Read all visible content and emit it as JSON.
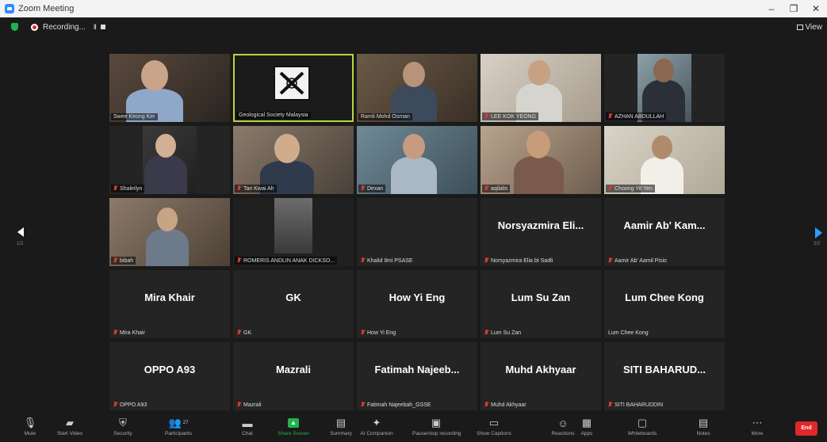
{
  "window": {
    "title": "Zoom Meeting",
    "controls": [
      "–",
      "❐",
      "✕"
    ]
  },
  "topbar": {
    "recording_label": "Recording...",
    "pause_label": "II",
    "view_label": "View"
  },
  "pagination": {
    "left_page": "1/2",
    "right_page": "2/2"
  },
  "tiles": [
    {
      "name": "Swee Keong Ker",
      "video": true,
      "muted": false
    },
    {
      "name": "Geological Society Malaysia",
      "video": true,
      "muted": false,
      "active": true
    },
    {
      "name": "Ramli Mohd Osman",
      "video": true,
      "muted": false
    },
    {
      "name": "LEE KOK YEONG",
      "video": true,
      "muted": true
    },
    {
      "name": "AZHAN ABDULLAH",
      "video": true,
      "muted": true
    },
    {
      "name": "Shaleilyn",
      "video": true,
      "muted": true
    },
    {
      "name": "Tan Kwai Ah",
      "video": true,
      "muted": true
    },
    {
      "name": "Dexan",
      "video": true,
      "muted": true
    },
    {
      "name": "aqilalis",
      "video": true,
      "muted": true
    },
    {
      "name": "Choong Yit Yen",
      "video": true,
      "muted": true
    },
    {
      "name": "bibah",
      "video": true,
      "muted": true
    },
    {
      "name": "ROMERIS ANDLIN ANAK DICKSO...",
      "video": true,
      "muted": true
    },
    {
      "name": "Khalid Ilmi PSASE",
      "display": "",
      "video": false,
      "muted": true
    },
    {
      "name": "Norsyazmira Elia bt Sadli",
      "display": "Norsyazmira  Eli...",
      "video": false,
      "muted": true
    },
    {
      "name": "Aamir Ab' Aamil Pisio",
      "display": "Aamir  Ab'  Kam...",
      "video": false,
      "muted": true
    },
    {
      "name": "Mira Khair",
      "display": "Mira Khair",
      "video": false,
      "muted": true
    },
    {
      "name": "GK",
      "display": "GK",
      "video": false,
      "muted": true
    },
    {
      "name": "How Yi Eng",
      "display": "How Yi Eng",
      "video": false,
      "muted": true
    },
    {
      "name": "Lum Su Zan",
      "display": "Lum Su Zan",
      "video": false,
      "muted": true
    },
    {
      "name": "Lum Chee Kong",
      "display": "Lum Chee Kong",
      "video": false,
      "muted": false
    },
    {
      "name": "OPPO A93",
      "display": "OPPO A93",
      "video": false,
      "muted": true
    },
    {
      "name": "Mazrali",
      "display": "Mazrali",
      "video": false,
      "muted": true
    },
    {
      "name": "Fatimah Najeebah_GSSE",
      "display": "Fatimah  Najeeb...",
      "video": false,
      "muted": true
    },
    {
      "name": "Muhd Akhyaar",
      "display": "Muhd Akhyaar",
      "video": false,
      "muted": true
    },
    {
      "name": "SITI BAHARUDDIN",
      "display": "SITI  BAHARUD...",
      "video": false,
      "muted": true
    }
  ],
  "toolbar": {
    "items": [
      {
        "key": "mute",
        "label": "Mute",
        "icon": "microphone-icon"
      },
      {
        "key": "video",
        "label": "Start Video",
        "icon": "video-off-icon"
      },
      {
        "key": "security",
        "label": "Security",
        "icon": "shield-icon"
      },
      {
        "key": "participants",
        "label": "Participants",
        "icon": "participants-icon",
        "count": "27"
      },
      {
        "key": "chat",
        "label": "Chat",
        "icon": "chat-icon"
      },
      {
        "key": "share",
        "label": "Share Screen",
        "icon": "share-screen-icon"
      },
      {
        "key": "summary",
        "label": "Summary",
        "icon": "summary-icon"
      },
      {
        "key": "ai",
        "label": "AI Companion",
        "icon": "sparkle-icon"
      },
      {
        "key": "record",
        "label": "Pause/stop recording",
        "icon": "record-icon"
      },
      {
        "key": "captions",
        "label": "Show Captions",
        "icon": "captions-icon"
      },
      {
        "key": "reactions",
        "label": "Reactions",
        "icon": "reactions-icon"
      },
      {
        "key": "apps",
        "label": "Apps",
        "icon": "apps-icon"
      },
      {
        "key": "whiteboards",
        "label": "Whiteboards",
        "icon": "whiteboard-icon"
      },
      {
        "key": "notes",
        "label": "Notes",
        "icon": "notes-icon"
      },
      {
        "key": "more",
        "label": "More",
        "icon": "more-icon"
      }
    ],
    "end_label": "End"
  },
  "colors": {
    "accent_green": "#23b14d",
    "active_border": "#b8d63d",
    "end_red": "#e02828",
    "arrow_blue": "#2d9cff"
  }
}
